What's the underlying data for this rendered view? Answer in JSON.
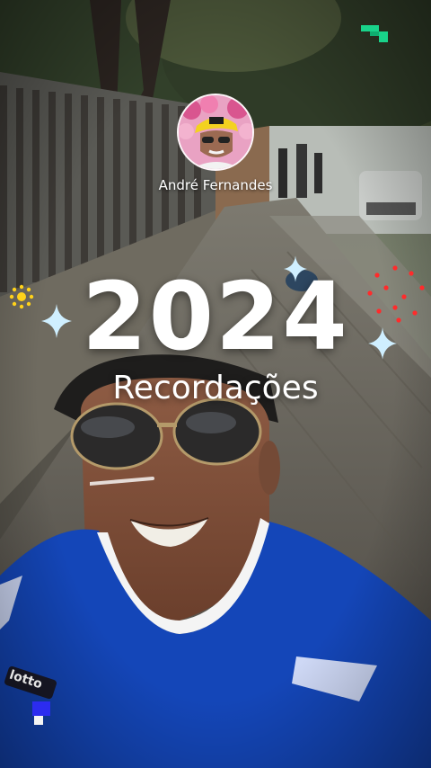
{
  "profile": {
    "name": "André Fernandes"
  },
  "memory": {
    "year": "2024",
    "subtitle": "Recordações"
  },
  "photo": {
    "shirt_logo": "lotto"
  },
  "colors": {
    "accent_green": "#19d38a",
    "sparkle_blue": "#cfefff",
    "dots_red": "#ff2b2b",
    "sun_yellow": "#ffd21a",
    "shirt_blue": "#1446b8"
  },
  "icons": {
    "top_right": "green-pixel-icon",
    "bottom_left": "blue-pixel-icon",
    "sparkles": "sparkle-icon",
    "sun": "sun-icon",
    "red_dots": "dot-circle-icon"
  }
}
